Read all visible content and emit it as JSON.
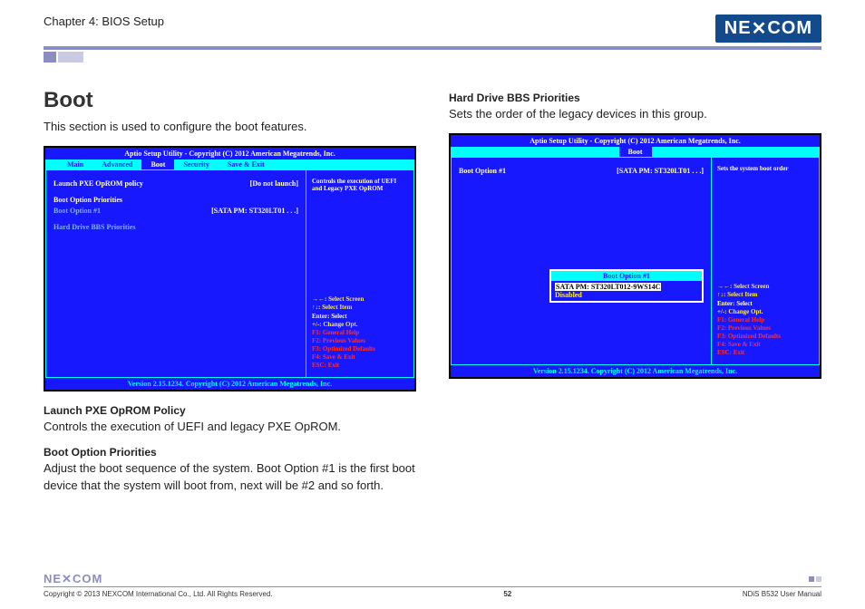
{
  "header": {
    "chapter": "Chapter 4: BIOS Setup",
    "logo_text": "NEXCOM"
  },
  "left": {
    "h1": "Boot",
    "intro": "This section is used to configure the boot features.",
    "sub1_title": "Launch PXE OpROM Policy",
    "sub1_text": "Controls the execution of UEFI and legacy PXE OpROM.",
    "sub2_title": "Boot Option Priorities",
    "sub2_text": "Adjust the boot sequence of the system. Boot Option #1 is the first boot device that the system will boot from, next will be #2 and so forth."
  },
  "right": {
    "sub1_title": "Hard Drive BBS Priorities",
    "sub1_text": "Sets the order of the legacy devices in this group."
  },
  "bios_shared": {
    "header": "Aptio Setup Utility - Copyright (C) 2012 American Megatrends, Inc.",
    "footer": "Version 2.15.1234. Copyright (C) 2012 American Megatrends, Inc.",
    "tabs": {
      "main": "Main",
      "advanced": "Advanced",
      "boot": "Boot",
      "security": "Security",
      "save": "Save & Exit"
    },
    "keys": {
      "k1": "→←: Select Screen",
      "k2": "↑↓: Select Item",
      "k3": "Enter: Select",
      "k4": "+/-: Change Opt.",
      "k5": "F1: General Help",
      "k6": "F2: Previous Values",
      "k7": "F3: Optimized Defaults",
      "k8": "F4: Save & Exit",
      "k9": "ESC: Exit"
    }
  },
  "bios1": {
    "row1_label": "Launch PXE OpROM policy",
    "row1_value": "[Do not launch]",
    "row2_label": "Boot Option Priorities",
    "row3_label": "Boot Option #1",
    "row3_value": "[SATA  PM:  ST320LT01 . . .]",
    "row4_label": "Hard Drive BBS Priorities",
    "help_text": "Controls the execution of UEFI and Legacy PXE OpROM"
  },
  "bios2": {
    "row1_label": "Boot Option #1",
    "row1_value": "[SATA  PM:  ST320LT01 . . .]",
    "help_text": "Sets the system boot order",
    "popup_title": "Boot Option #1",
    "popup_line1": "SATA PM: ST320LT012-9WS14C",
    "popup_line2": "Disabled"
  },
  "footer": {
    "copyright": "Copyright © 2013 NEXCOM International Co., Ltd. All Rights Reserved.",
    "page": "52",
    "doc": "NDiS B532 User Manual"
  }
}
